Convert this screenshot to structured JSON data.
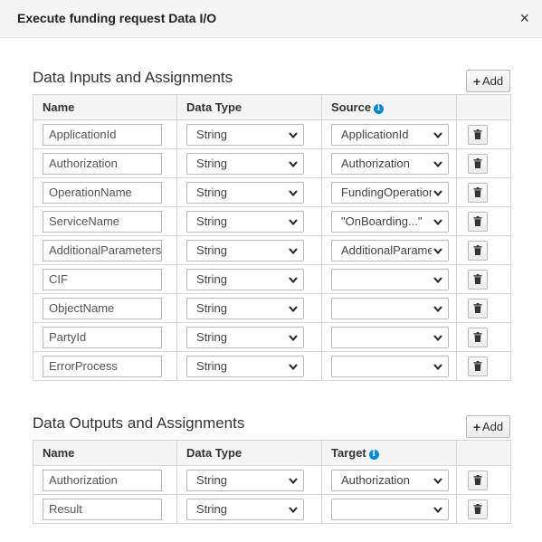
{
  "dialog": {
    "title": "Execute funding request Data I/O",
    "close_glyph": "×"
  },
  "inputs": {
    "section_title": "Data Inputs and Assignments",
    "add_label": "Add",
    "headers": {
      "name": "Name",
      "type": "Data Type",
      "source": "Source"
    },
    "rows": [
      {
        "name": "ApplicationId",
        "type": "String",
        "source": "ApplicationId"
      },
      {
        "name": "Authorization",
        "type": "String",
        "source": "Authorization"
      },
      {
        "name": "OperationName",
        "type": "String",
        "source": "FundingOperation"
      },
      {
        "name": "ServiceName",
        "type": "String",
        "source": "\"OnBoarding...\""
      },
      {
        "name": "AdditionalParameters",
        "type": "String",
        "source": "AdditionalParameters"
      },
      {
        "name": "CIF",
        "type": "String",
        "source": ""
      },
      {
        "name": "ObjectName",
        "type": "String",
        "source": ""
      },
      {
        "name": "PartyId",
        "type": "String",
        "source": ""
      },
      {
        "name": "ErrorProcess",
        "type": "String",
        "source": ""
      }
    ]
  },
  "outputs": {
    "section_title": "Data Outputs and Assignments",
    "add_label": "Add",
    "headers": {
      "name": "Name",
      "type": "Data Type",
      "target": "Target"
    },
    "rows": [
      {
        "name": "Authorization",
        "type": "String",
        "target": "Authorization"
      },
      {
        "name": "Result",
        "type": "String",
        "target": ""
      }
    ]
  },
  "icons": {
    "info": "info-circle-icon",
    "delete": "trash-icon",
    "add": "plus-icon",
    "dropdown": "chevron-down-icon"
  },
  "colors": {
    "info_accent": "#0088ce",
    "header_bg": "#f5f5f5"
  }
}
